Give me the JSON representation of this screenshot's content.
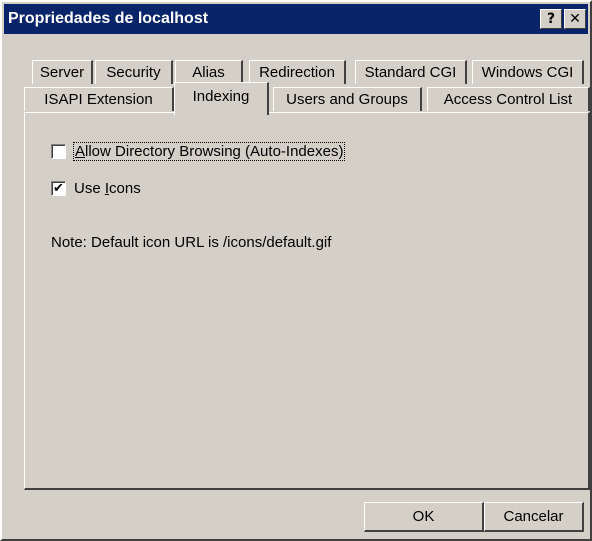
{
  "window": {
    "title": "Propriedades de localhost",
    "help_button": "?",
    "close_button": "✕"
  },
  "tabs_row1": [
    {
      "label": "Server"
    },
    {
      "label": "Security"
    },
    {
      "label": "Alias"
    },
    {
      "label": "Redirection"
    },
    {
      "label": "Standard CGI"
    },
    {
      "label": "Windows CGI"
    }
  ],
  "tabs_row2": [
    {
      "label": "ISAPI Extension"
    },
    {
      "label": "Indexing",
      "active": true
    },
    {
      "label": "Users and Groups"
    },
    {
      "label": "Access Control List"
    }
  ],
  "indexing": {
    "allow_browsing": {
      "checked": false,
      "label_first": "A",
      "label_rest": "llow Directory Browsing (Auto-Indexes)"
    },
    "use_icons": {
      "checked": true,
      "check_mark": "✔",
      "label_before": "Use ",
      "label_accel": "I",
      "label_after": "cons"
    },
    "note": "Note: Default icon URL is /icons/default.gif"
  },
  "buttons": {
    "ok": "OK",
    "cancel": "Cancelar"
  }
}
